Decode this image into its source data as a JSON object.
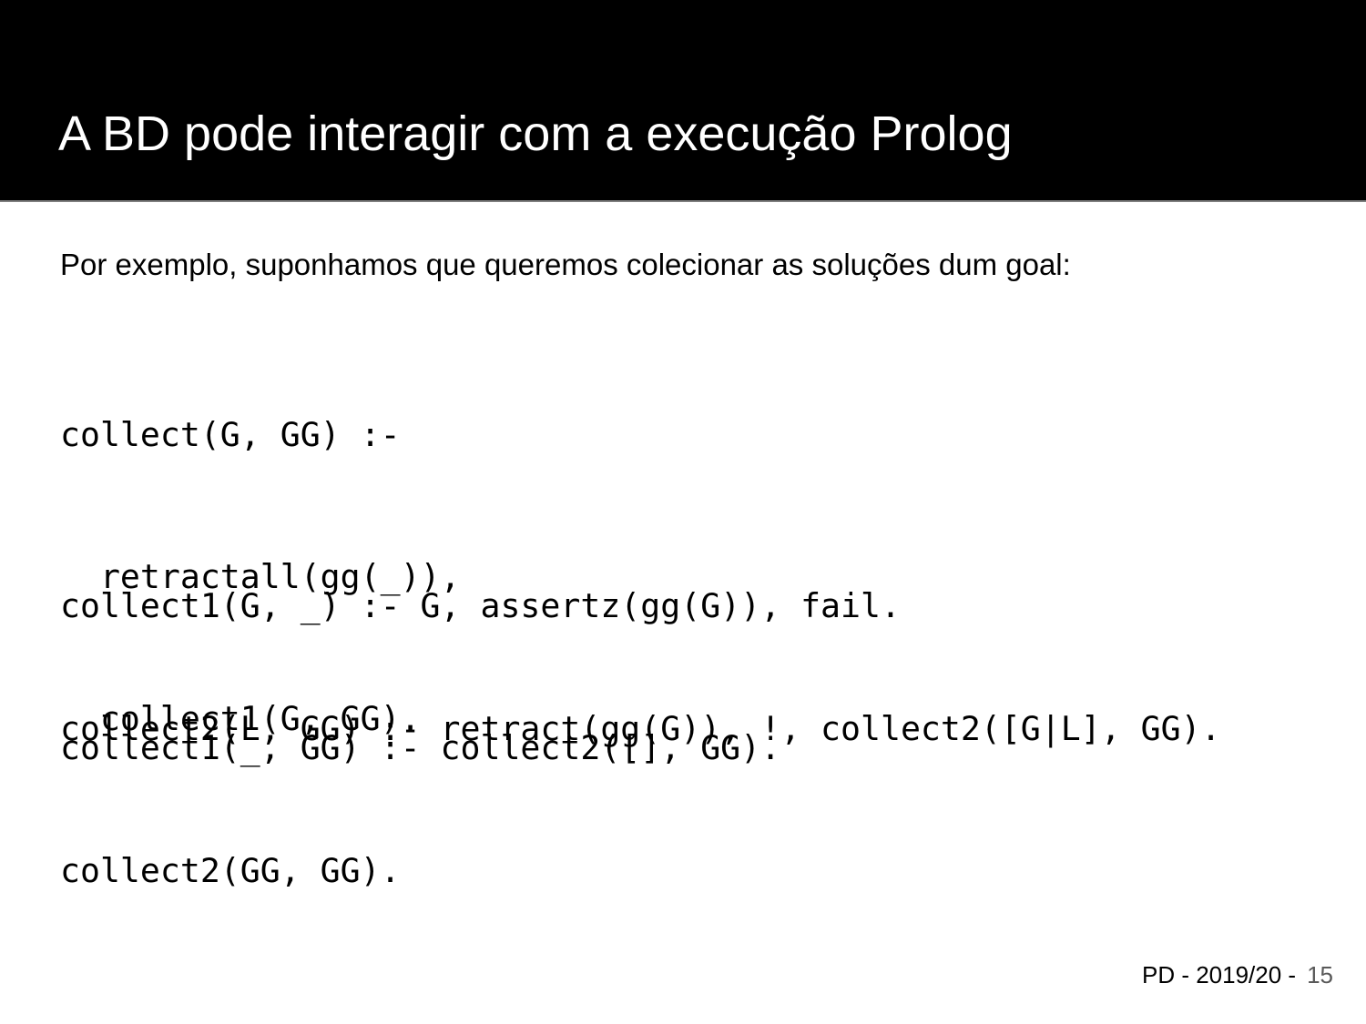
{
  "slide": {
    "title": "A BD pode interagir com a execução Prolog",
    "intro": "Por exemplo, suponhamos que queremos colecionar as soluções dum goal:"
  },
  "code": {
    "block1": [
      "collect(G, GG) :-",
      "  retractall(gg(_)),",
      "  collect1(G, GG)."
    ],
    "block2": [
      "collect1(G, _) :- G, assertz(gg(G)), fail.",
      "collect1(_, GG) :- collect2([], GG)."
    ],
    "block3": [
      "collect2(L, GG) :- retract(gg(G)), !, collect2([G|L], GG).",
      "collect2(GG, GG)."
    ]
  },
  "footer": {
    "label": "PD - 2019/20 -",
    "page_number": "15"
  },
  "colors": {
    "header_background": "#000000",
    "title_text": "#ffffff",
    "body_text": "#000000",
    "page_number": "#595959"
  }
}
